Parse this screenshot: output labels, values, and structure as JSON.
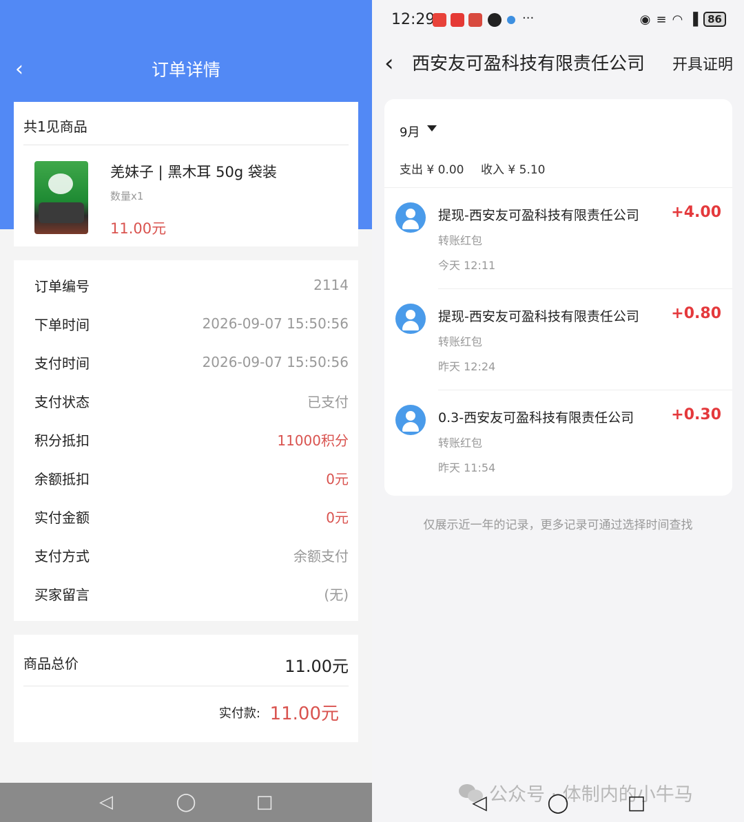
{
  "left": {
    "header": {
      "title": "订单详情"
    },
    "goods": {
      "count_label": "共1见商品",
      "name": "羌妹子 | 黑木耳 50g 袋装",
      "quantity": "数量x1",
      "price": "11.00元"
    },
    "info_rows": [
      {
        "label": "订单编号",
        "value": "2114",
        "highlight": false
      },
      {
        "label": "下单时间",
        "value": "2026-09-07 15:50:56",
        "highlight": false
      },
      {
        "label": "支付时间",
        "value": "2026-09-07 15:50:56",
        "highlight": false
      },
      {
        "label": "支付状态",
        "value": "已支付",
        "highlight": false
      },
      {
        "label": "积分抵扣",
        "value": "11000积分",
        "highlight": true
      },
      {
        "label": "余额抵扣",
        "value": "0元",
        "highlight": true
      },
      {
        "label": "实付金额",
        "value": "0元",
        "highlight": true
      },
      {
        "label": "支付方式",
        "value": "余额支付",
        "highlight": false
      },
      {
        "label": "买家留言",
        "value": "(无)",
        "highlight": false
      }
    ],
    "total": {
      "label": "商品总价",
      "value": "11.00元",
      "paid_label": "实付款:",
      "paid_value": "11.00元"
    },
    "colors": {
      "header_blue": "#5289f5",
      "price_red": "#d9534f"
    }
  },
  "right": {
    "status_bar": {
      "time": "12:29",
      "more": "···",
      "battery": "86"
    },
    "header": {
      "title": "西安友可盈科技有限责任公司",
      "action": "开具证明"
    },
    "month": "9月",
    "summary": {
      "out": "支出 ¥ 0.00",
      "in": "收入 ¥ 5.10"
    },
    "transactions": [
      {
        "name": "提现-西安友可盈科技有限责任公司",
        "amount": "+4.00",
        "type": "转账红包",
        "time": "今天 12:11"
      },
      {
        "name": "提现-西安友可盈科技有限责任公司",
        "amount": "+0.80",
        "type": "转账红包",
        "time": "昨天 12:24"
      },
      {
        "name": "0.3-西安友可盈科技有限责任公司",
        "amount": "+0.30",
        "type": "转账红包",
        "time": "昨天 11:54"
      }
    ],
    "footnote": "仅展示近一年的记录，更多记录可通过选择时间查找",
    "watermark": "公众号 · 体制内的小牛马",
    "colors": {
      "amount_red": "#e4393c",
      "avatar_blue": "#4a9bea"
    }
  },
  "icons": {
    "back": "chevron-left-icon",
    "nav_back": "triangle-back-icon",
    "nav_home": "circle-home-icon",
    "nav_recents": "square-recents-icon"
  }
}
